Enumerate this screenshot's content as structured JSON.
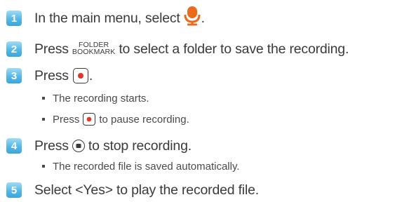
{
  "colors": {
    "step_badge": "#55b7e6",
    "record_dot": "#e0392b",
    "mic_icon": "#ec6a1e"
  },
  "steps": [
    {
      "num": "1",
      "text": "In the main menu, select",
      "after_icon": "."
    },
    {
      "num": "2",
      "pre": "Press",
      "key_top": "FOLDER",
      "key_bottom": "BOOKMARK",
      "post": "to select a folder to save the recording."
    },
    {
      "num": "3",
      "pre": "Press",
      "post": "."
    },
    {
      "num": "4",
      "pre": "Press",
      "post": "to stop recording."
    },
    {
      "num": "5",
      "text": "Select <Yes> to play the recorded file."
    }
  ],
  "step3_notes": {
    "note1": "The recording starts.",
    "note2_pre": "Press",
    "note2_post": "to pause recording."
  },
  "step4_notes": {
    "note1": "The recorded file is saved automatically."
  }
}
